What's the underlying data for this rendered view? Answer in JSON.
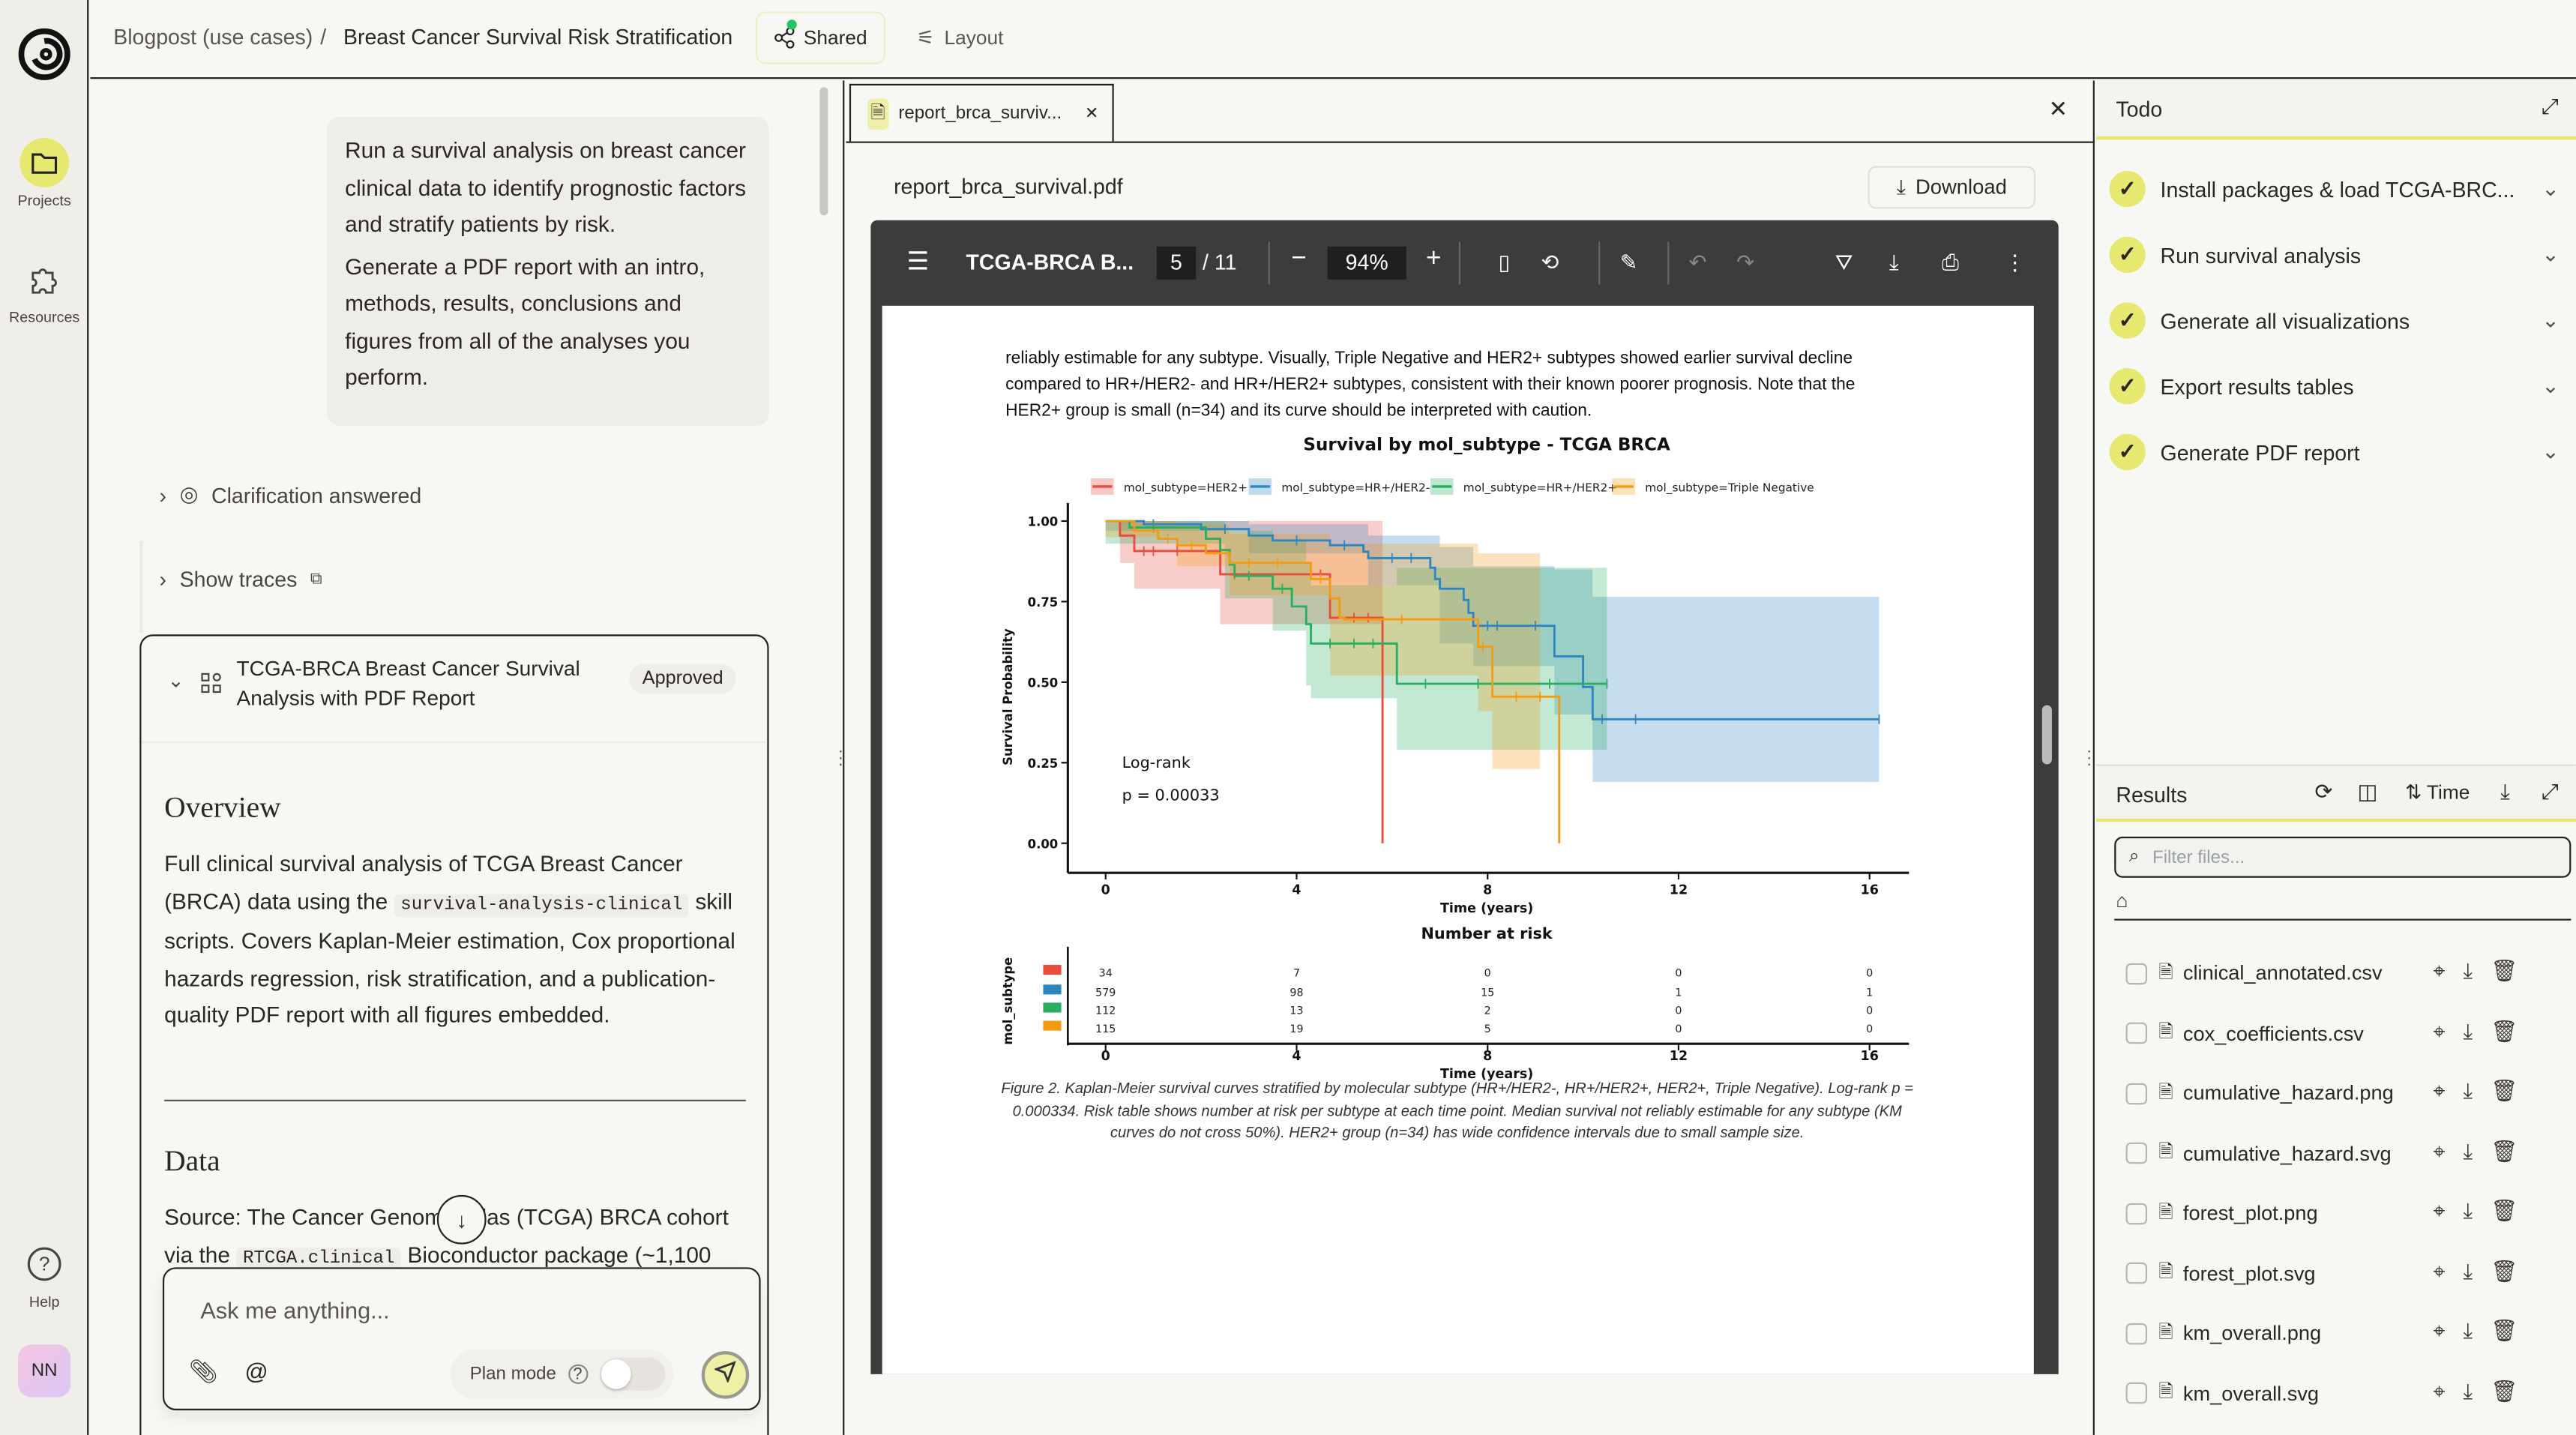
{
  "rail": {
    "projects": "Projects",
    "resources": "Resources",
    "help": "Help",
    "avatar": "NN",
    "accent": "#e6e86f"
  },
  "header": {
    "breadcrumb_parent": "Blogpost (use cases)",
    "separator": "/",
    "breadcrumb_current": "Breast Cancer Survival Risk Stratification",
    "shared": "Shared",
    "layout": "Layout"
  },
  "chat": {
    "user_message_1": "Run a survival analysis on breast cancer clinical data to identify prognostic factors and stratify patients by risk.",
    "user_message_2": "Generate a PDF report with an intro, methods, results, conclusions and figures from all of the analyses you perform.",
    "clarification": "Clarification answered",
    "show_traces": "Show traces",
    "plan": {
      "title": "TCGA-BRCA Breast Cancer Survival Analysis with PDF Report",
      "status": "Approved",
      "overview_heading": "Overview",
      "overview_1": "Full clinical survival analysis of TCGA Breast Cancer (BRCA) data using the",
      "overview_code": "survival-analysis-clinical",
      "overview_2": "skill scripts. Covers Kaplan-Meier estimation, Cox proportional hazards regression, risk stratification, and a publication-quality PDF report with all figures embedded.",
      "data_heading": "Data",
      "data_1": "Source: The Cancer Genome Atlas (TCGA) BRCA cohort via the",
      "data_code": "RTCGA.clinical",
      "data_2": "Bioconductor package (~1,100"
    },
    "input_placeholder": "Ask me anything...",
    "plan_mode": "Plan mode",
    "plan_mode_on": false
  },
  "viewer": {
    "tab_label": "report_brca_surviv...",
    "filename": "report_brca_survival.pdf",
    "download": "Download",
    "pdf_title": "TCGA-BRCA B...",
    "page": "5",
    "pages": "/ 11",
    "zoom": "94%",
    "para": "reliably estimable for any subtype. Visually, Triple Negative and HER2+ subtypes showed earlier survival decline compared to HR+/HER2- and HR+/HER2+ subtypes, consistent with their known poorer prognosis. Note that the HER2+ group is small (n=34) and its curve should be interpreted with caution.",
    "caption": "Figure 2. Kaplan-Meier survival curves stratified by molecular subtype (HR+/HER2-, HR+/HER2+, HER2+, Triple Negative). Log-rank p = 0.000334. Risk table shows number at risk per subtype at each time point. Median survival not reliably estimable for any subtype (KM curves do not cross 50%). HER2+ group (n=34) has wide confidence intervals due to small sample size."
  },
  "chart_data": {
    "type": "line",
    "title": "Survival by mol_subtype - TCGA BRCA",
    "xlabel": "Time (years)",
    "ylabel": "Survival Probability",
    "xlim": [
      -1,
      17
    ],
    "ylim": [
      -0.05,
      1.05
    ],
    "xticks": [
      0,
      4,
      8,
      12,
      16
    ],
    "yticks": [
      "0.00",
      "0.25",
      "0.50",
      "0.75",
      "1.00"
    ],
    "legend_position": "top",
    "annotation": [
      "Log-rank",
      "p = 0.00033"
    ],
    "series": [
      {
        "name": "mol_subtype=HER2+",
        "color": "#e74c3c",
        "steps": [
          [
            0,
            1
          ],
          [
            0.3,
            0.955
          ],
          [
            0.6,
            0.907
          ],
          [
            2.4,
            0.835
          ],
          [
            4.7,
            0.7
          ],
          [
            5.8,
            0.0
          ]
        ],
        "ci": [
          [
            0,
            1,
            1
          ],
          [
            0.3,
            0.87,
            1
          ],
          [
            0.6,
            0.79,
            1
          ],
          [
            2.4,
            0.68,
            1
          ],
          [
            5.8,
            0,
            0
          ]
        ],
        "censor": [
          [
            0.8,
            0.907
          ],
          [
            1.0,
            0.907
          ],
          [
            1.5,
            0.907
          ],
          [
            2.7,
            0.835
          ],
          [
            4.5,
            0.835
          ],
          [
            5.2,
            0.7
          ],
          [
            5.5,
            0.7
          ]
        ]
      },
      {
        "name": "mol_subtype=HR+/HER2-",
        "color": "#2e86c1",
        "steps": [
          [
            0,
            1
          ],
          [
            0.8,
            0.99
          ],
          [
            2,
            0.975
          ],
          [
            3,
            0.955
          ],
          [
            3.5,
            0.94
          ],
          [
            4.7,
            0.925
          ],
          [
            5.4,
            0.905
          ],
          [
            5.5,
            0.885
          ],
          [
            6.8,
            0.855
          ],
          [
            6.9,
            0.82
          ],
          [
            7.0,
            0.79
          ],
          [
            7.5,
            0.755
          ],
          [
            7.6,
            0.715
          ],
          [
            7.7,
            0.675
          ],
          [
            9.4,
            0.58
          ],
          [
            10,
            0.485
          ],
          [
            10.2,
            0.385
          ],
          [
            16.2,
            0.385
          ]
        ],
        "ci": [
          [
            0,
            0.97,
            1
          ],
          [
            3,
            0.9,
            0.99
          ],
          [
            5.5,
            0.8,
            0.955
          ],
          [
            7,
            0.62,
            0.92
          ],
          [
            7.7,
            0.55,
            0.86
          ],
          [
            9.4,
            0.4,
            0.85
          ],
          [
            10.2,
            0.19,
            0.765
          ],
          [
            16.2,
            0,
            0
          ]
        ],
        "censor": [
          [
            1,
            0.99
          ],
          [
            2.5,
            0.975
          ],
          [
            4,
            0.94
          ],
          [
            5,
            0.925
          ],
          [
            6,
            0.885
          ],
          [
            6.4,
            0.885
          ],
          [
            8,
            0.675
          ],
          [
            8.2,
            0.675
          ],
          [
            9,
            0.675
          ],
          [
            10.4,
            0.385
          ],
          [
            11.1,
            0.385
          ],
          [
            16.2,
            0.385
          ]
        ]
      },
      {
        "name": "mol_subtype=HR+/HER2+",
        "color": "#27ae60",
        "steps": [
          [
            0,
            1
          ],
          [
            0.5,
            0.98
          ],
          [
            2.1,
            0.945
          ],
          [
            2.4,
            0.91
          ],
          [
            2.6,
            0.865
          ],
          [
            2.7,
            0.83
          ],
          [
            3.5,
            0.79
          ],
          [
            3.9,
            0.735
          ],
          [
            4.2,
            0.68
          ],
          [
            4.3,
            0.62
          ],
          [
            6.1,
            0.495
          ],
          [
            10.5,
            0.495
          ]
        ],
        "ci": [
          [
            0,
            0.93,
            1
          ],
          [
            2.5,
            0.76,
            0.97
          ],
          [
            3.5,
            0.66,
            0.94
          ],
          [
            4.2,
            0.49,
            0.87
          ],
          [
            4.3,
            0.45,
            0.8
          ],
          [
            6.1,
            0.29,
            0.855
          ],
          [
            10.5,
            0,
            0
          ]
        ],
        "censor": [
          [
            1,
            0.98
          ],
          [
            3,
            0.83
          ],
          [
            3.7,
            0.79
          ],
          [
            4.7,
            0.62
          ],
          [
            5.2,
            0.62
          ],
          [
            5.6,
            0.62
          ],
          [
            6.7,
            0.495
          ],
          [
            7.8,
            0.495
          ],
          [
            9.3,
            0.495
          ],
          [
            10.5,
            0.495
          ]
        ]
      },
      {
        "name": "mol_subtype=Triple Negative",
        "color": "#f39c12",
        "steps": [
          [
            0,
            1
          ],
          [
            0.6,
            0.97
          ],
          [
            1.1,
            0.945
          ],
          [
            1.5,
            0.925
          ],
          [
            2.1,
            0.9
          ],
          [
            2.6,
            0.87
          ],
          [
            4.3,
            0.82
          ],
          [
            4.7,
            0.76
          ],
          [
            4.9,
            0.7
          ],
          [
            5,
            0.695
          ],
          [
            7.8,
            0.61
          ],
          [
            8.1,
            0.455
          ],
          [
            9.5,
            0.0
          ]
        ],
        "ci": [
          [
            0,
            0.95,
            1
          ],
          [
            1.5,
            0.86,
            0.99
          ],
          [
            2.6,
            0.77,
            0.96
          ],
          [
            4.7,
            0.52,
            0.93
          ],
          [
            7.8,
            0.41,
            0.9
          ],
          [
            8.1,
            0.23,
            0.9
          ],
          [
            9.1,
            0,
            0
          ]
        ],
        "censor": [
          [
            1.3,
            0.945
          ],
          [
            1.8,
            0.925
          ],
          [
            3,
            0.87
          ],
          [
            3.6,
            0.87
          ],
          [
            4.5,
            0.82
          ],
          [
            6.2,
            0.695
          ],
          [
            7.9,
            0.61
          ],
          [
            8.6,
            0.455
          ],
          [
            9.1,
            0.455
          ]
        ]
      }
    ],
    "risk_table": {
      "title": "Number at risk",
      "ylabel": "mol_subtype",
      "xlabel": "Time (years)",
      "times": [
        0,
        4,
        8,
        12,
        16
      ],
      "rows": [
        [
          34,
          7,
          0,
          0,
          0
        ],
        [
          579,
          98,
          15,
          1,
          1
        ],
        [
          112,
          13,
          2,
          0,
          0
        ],
        [
          115,
          19,
          5,
          0,
          0
        ]
      ]
    }
  },
  "todo": {
    "title": "Todo",
    "items": [
      {
        "label": "Install packages & load TCGA-BRC...",
        "done": true
      },
      {
        "label": "Run survival analysis",
        "done": true
      },
      {
        "label": "Generate all visualizations",
        "done": true
      },
      {
        "label": "Export results tables",
        "done": true
      },
      {
        "label": "Generate PDF report",
        "done": true
      }
    ]
  },
  "results": {
    "title": "Results",
    "sort": "Time",
    "filter_placeholder": "Filter files...",
    "files": [
      "clinical_annotated.csv",
      "cox_coefficients.csv",
      "cumulative_hazard.png",
      "cumulative_hazard.svg",
      "forest_plot.png",
      "forest_plot.svg",
      "km_overall.png",
      "km_overall.svg"
    ]
  }
}
